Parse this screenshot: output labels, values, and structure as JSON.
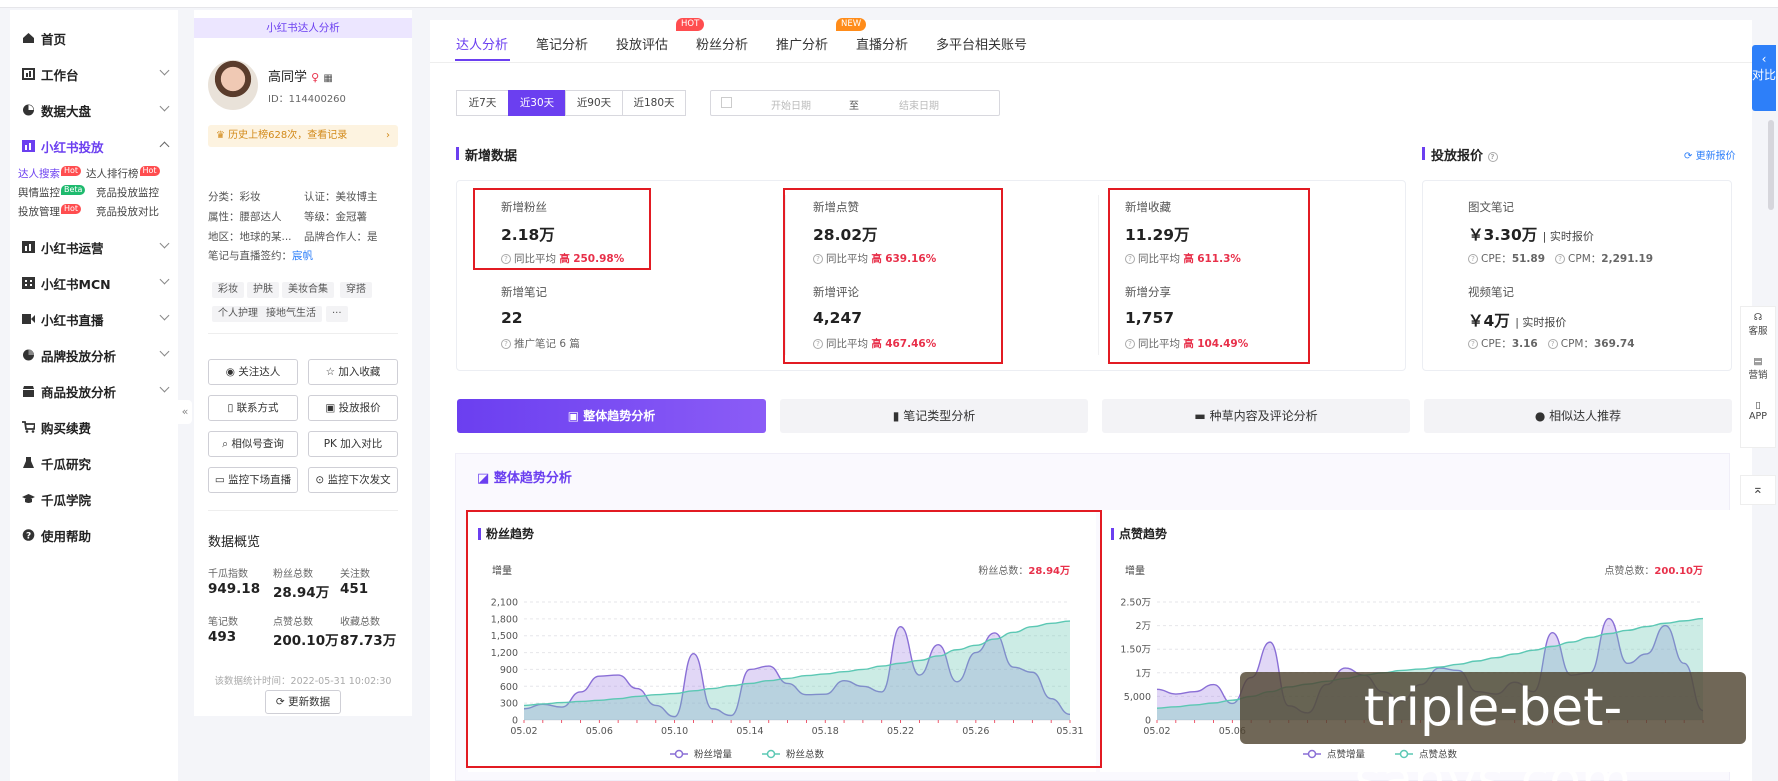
{
  "sidebar": {
    "items": [
      {
        "label": "首页",
        "icon": "home-icon"
      },
      {
        "label": "工作台",
        "icon": "workbench-icon"
      },
      {
        "label": "数据大盘",
        "icon": "dashboard-icon"
      },
      {
        "label": "小红书投放",
        "icon": "chart-bar-icon"
      },
      {
        "label": "小红书运营",
        "icon": "chart-bar-icon"
      },
      {
        "label": "小红书MCN",
        "icon": "building-icon"
      },
      {
        "label": "小红书直播",
        "icon": "video-icon"
      },
      {
        "label": "品牌投放分析",
        "icon": "pie-icon"
      },
      {
        "label": "商品投放分析",
        "icon": "shop-icon"
      },
      {
        "label": "购买续费",
        "icon": "cart-icon"
      },
      {
        "label": "千瓜研究",
        "icon": "flask-icon"
      },
      {
        "label": "千瓜学院",
        "icon": "graduation-icon"
      },
      {
        "label": "使用帮助",
        "icon": "help-icon"
      }
    ],
    "subitems": [
      {
        "label": "达人搜索",
        "tag": "Hot"
      },
      {
        "label": "达人排行榜",
        "tag": "Hot"
      },
      {
        "label": "舆情监控",
        "tag": "Beta"
      },
      {
        "label": "竞品投放监控",
        "tag": ""
      },
      {
        "label": "投放管理",
        "tag": "Hot"
      },
      {
        "label": "竞品投放对比",
        "tag": ""
      }
    ],
    "collapse_glyph": "«"
  },
  "profile": {
    "header": "小红书达人分析",
    "name": "高同学",
    "id": "ID：114400260",
    "history": "历史上榜628次，查看记录",
    "meta": {
      "category": "分类：彩妆",
      "cert": "认证：美妆博主",
      "attr": "属性：腰部达人",
      "level": "等级：金冠薯",
      "region": "地区：地球的某...",
      "brand_partner": "品牌合作人：是",
      "signed_label": "笔记与直播签约：",
      "signed_value": "宸帆"
    },
    "chips": [
      "彩妆",
      "护肤",
      "美妆合集",
      "穿搭",
      "个人护理",
      "接地气生活",
      "···"
    ],
    "buttons": [
      "关注达人",
      "加入收藏",
      "联系方式",
      "投放报价",
      "相似号查询",
      "PK 加入对比",
      "监控下场直播",
      "监控下次发文"
    ],
    "overview": {
      "title": "数据概览",
      "items": [
        {
          "label": "千瓜指数",
          "value": "949.18"
        },
        {
          "label": "粉丝总数",
          "value": "28.94万"
        },
        {
          "label": "关注数",
          "value": "451"
        },
        {
          "label": "笔记数",
          "value": "493"
        },
        {
          "label": "点赞总数",
          "value": "200.10万"
        },
        {
          "label": "收藏总数",
          "value": "87.73万"
        }
      ],
      "stat_time": "该数据统计时间：2022-05-31 10:02:30",
      "refresh": "更新数据"
    }
  },
  "main": {
    "tabs": [
      "达人分析",
      "笔记分析",
      "投放评估",
      "粉丝分析",
      "推广分析",
      "直播分析",
      "多平台相关账号"
    ],
    "badges": {
      "hot": "HOT",
      "new": "NEW"
    },
    "day_buttons": [
      "近7天",
      "近30天",
      "近90天",
      "近180天"
    ],
    "date_start": "开始日期",
    "date_sep": "至",
    "date_end": "结束日期",
    "new_data_title": "新增数据",
    "stats": [
      {
        "label": "新增粉丝",
        "value": "2.18万",
        "cmp": "同比平均",
        "dir": "高",
        "pct": "250.98%"
      },
      {
        "label": "新增笔记",
        "value": "22",
        "cmp": "推广笔记 6 篇"
      },
      {
        "label": "新增点赞",
        "value": "28.02万",
        "cmp": "同比平均",
        "dir": "高",
        "pct": "639.16%"
      },
      {
        "label": "新增评论",
        "value": "4,247",
        "cmp": "同比平均",
        "dir": "高",
        "pct": "467.46%"
      },
      {
        "label": "新增收藏",
        "value": "11.29万",
        "cmp": "同比平均",
        "dir": "高",
        "pct": "611.3%"
      },
      {
        "label": "新增分享",
        "value": "1,757",
        "cmp": "同比平均",
        "dir": "高",
        "pct": "104.49%"
      }
    ],
    "quote": {
      "title": "投放报价",
      "refresh": "更新报价",
      "image_label": "图文笔记",
      "image_value": "￥3.30万",
      "image_tag": "| 实时报价",
      "image_cpe_label": "CPE：",
      "image_cpe": "51.89",
      "image_cpm_label": "CPM：",
      "image_cpm": "2,291.19",
      "video_label": "视频笔记",
      "video_value": "￥4万",
      "video_tag": "| 实时报价",
      "video_cpe_label": "CPE：",
      "video_cpe": "3.16",
      "video_cpm_label": "CPM：",
      "video_cpm": "369.74"
    },
    "big_tabs": [
      "整体趋势分析",
      "笔记类型分析",
      "种草内容及评论分析",
      "相似达人推荐"
    ],
    "trend_title": "整体趋势分析"
  },
  "right_tools": {
    "compare": "对比",
    "service": "客服",
    "marketing": "营销",
    "app": "APP"
  },
  "watermark": "triple-bet-sanys.com",
  "colors": {
    "accent": "#6b3ff0",
    "red": "#e21b23",
    "up": "#e8304a",
    "purple_fill": "#c9b6ee",
    "teal_fill": "#8fd6c8"
  },
  "chart_data": [
    {
      "type": "area",
      "title": "粉丝趋势",
      "unit_label": "增量",
      "total_label": "粉丝总数：",
      "total_value": "28.94万",
      "x": [
        "05.02",
        "05.03",
        "05.04",
        "05.05",
        "05.06",
        "05.07",
        "05.08",
        "05.09",
        "05.10",
        "05.11",
        "05.12",
        "05.13",
        "05.14",
        "05.15",
        "05.16",
        "05.17",
        "05.18",
        "05.19",
        "05.20",
        "05.21",
        "05.22",
        "05.23",
        "05.24",
        "05.25",
        "05.26",
        "05.27",
        "05.28",
        "05.29",
        "05.30",
        "05.31"
      ],
      "x_ticks": [
        "05.02",
        "05.06",
        "05.10",
        "05.14",
        "05.18",
        "05.22",
        "05.26",
        "05.31"
      ],
      "ylim": [
        0,
        2100
      ],
      "y_ticks": [
        "0",
        "300",
        "600",
        "900",
        "1,200",
        "1,500",
        "1,800",
        "2,100"
      ],
      "series": [
        {
          "name": "粉丝增量",
          "color": "#8a6fd6",
          "values": [
            200,
            280,
            230,
            500,
            780,
            800,
            560,
            260,
            60,
            1180,
            200,
            80,
            900,
            960,
            650,
            450,
            460,
            700,
            600,
            500,
            1660,
            800,
            1340,
            680,
            1200,
            1550,
            940,
            850,
            380,
            100
          ]
        },
        {
          "name": "粉丝总数",
          "color": "#5cc8b4",
          "values": [
            260,
            285,
            310,
            330,
            350,
            380,
            420,
            450,
            470,
            520,
            560,
            610,
            650,
            700,
            740,
            790,
            820,
            860,
            900,
            960,
            1010,
            1060,
            1140,
            1250,
            1330,
            1440,
            1560,
            1660,
            1720,
            1760
          ]
        }
      ]
    },
    {
      "type": "area",
      "title": "点赞趋势",
      "unit_label": "增量",
      "total_label": "点赞总数：",
      "total_value": "200.10万",
      "x": [
        "05.02",
        "05.03",
        "05.04",
        "05.05",
        "05.06",
        "05.07",
        "05.08",
        "05.09",
        "05.10",
        "05.11",
        "05.12",
        "05.13",
        "05.14",
        "05.15",
        "05.16",
        "05.17",
        "05.18",
        "05.19",
        "05.20",
        "05.21",
        "05.22",
        "05.23",
        "05.24",
        "05.25",
        "05.26",
        "05.27",
        "05.28",
        "05.29",
        "05.30",
        "05.31"
      ],
      "x_ticks": [
        "05.02",
        "05.06"
      ],
      "ylim": [
        0,
        25000
      ],
      "y_ticks": [
        "0",
        "5,000",
        "1万",
        "1.50万",
        "2万",
        "2.50万"
      ],
      "series": [
        {
          "name": "点赞增量",
          "color": "#8a6fd6",
          "values": [
            6500,
            5500,
            6000,
            7500,
            3500,
            9000,
            16500,
            3000,
            1500,
            7500,
            11000,
            9500,
            6000,
            4000,
            7500,
            11000,
            10500,
            6000,
            5500,
            8000,
            6000,
            18500,
            9500,
            10000,
            21500,
            12000,
            14000,
            20000,
            12000,
            2000
          ]
        },
        {
          "name": "点赞总数",
          "color": "#5cc8b4",
          "values": [
            2500,
            2800,
            3200,
            3600,
            4200,
            5000,
            6000,
            7000,
            7600,
            8200,
            8800,
            9500,
            10000,
            10500,
            10800,
            11200,
            11800,
            12500,
            13200,
            14000,
            14800,
            15600,
            16500,
            17500,
            18300,
            19000,
            19800,
            20500,
            21000,
            21500
          ]
        }
      ]
    }
  ]
}
